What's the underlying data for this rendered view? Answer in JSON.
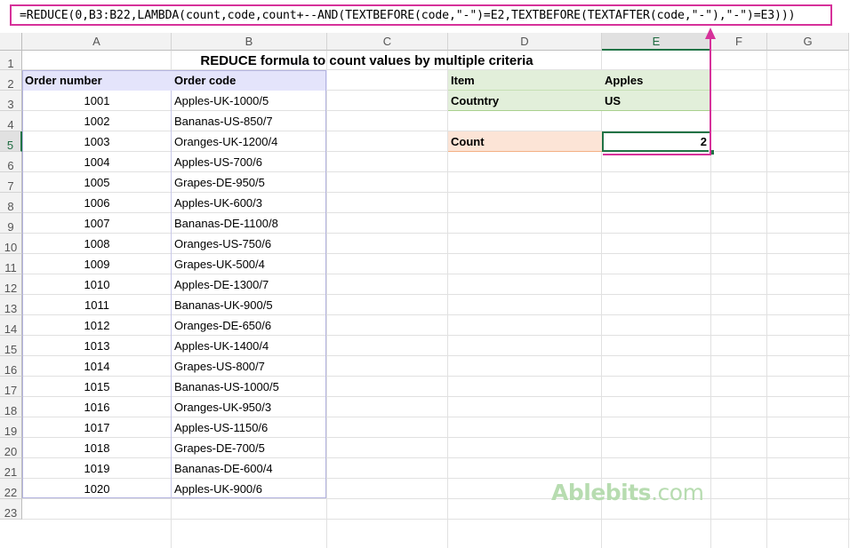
{
  "formula_bar": {
    "formula": "=REDUCE(0,B3:B22,LAMBDA(count,code,count+--AND(TEXTBEFORE(code,\"-\")=E2,TEXTBEFORE(TEXTAFTER(code,\"-\"),\"-\")=E3)))"
  },
  "columns": [
    "A",
    "B",
    "C",
    "D",
    "E",
    "F",
    "G"
  ],
  "selected_column": "E",
  "rows": [
    "1",
    "2",
    "3",
    "4",
    "5",
    "6",
    "7",
    "8",
    "9",
    "10",
    "11",
    "12",
    "13",
    "14",
    "15",
    "16",
    "17",
    "18",
    "19",
    "20",
    "21",
    "22",
    "23"
  ],
  "selected_row": "5",
  "sheet": {
    "title": "REDUCE formula to count values by multiple criteria",
    "table_headers": {
      "order_number": "Order number",
      "order_code": "Order code"
    },
    "table_rows": [
      {
        "number": "1001",
        "code": "Apples-UK-1000/5"
      },
      {
        "number": "1002",
        "code": "Bananas-US-850/7"
      },
      {
        "number": "1003",
        "code": "Oranges-UK-1200/4"
      },
      {
        "number": "1004",
        "code": "Apples-US-700/6"
      },
      {
        "number": "1005",
        "code": "Grapes-DE-950/5"
      },
      {
        "number": "1006",
        "code": "Apples-UK-600/3"
      },
      {
        "number": "1007",
        "code": "Bananas-DE-1100/8"
      },
      {
        "number": "1008",
        "code": "Oranges-US-750/6"
      },
      {
        "number": "1009",
        "code": "Grapes-UK-500/4"
      },
      {
        "number": "1010",
        "code": "Apples-DE-1300/7"
      },
      {
        "number": "1011",
        "code": "Bananas-UK-900/5"
      },
      {
        "number": "1012",
        "code": "Oranges-DE-650/6"
      },
      {
        "number": "1013",
        "code": "Apples-UK-1400/4"
      },
      {
        "number": "1014",
        "code": "Grapes-US-800/7"
      },
      {
        "number": "1015",
        "code": "Bananas-US-1000/5"
      },
      {
        "number": "1016",
        "code": "Oranges-UK-950/3"
      },
      {
        "number": "1017",
        "code": "Apples-US-1150/6"
      },
      {
        "number": "1018",
        "code": "Grapes-DE-700/5"
      },
      {
        "number": "1019",
        "code": "Bananas-DE-600/4"
      },
      {
        "number": "1020",
        "code": "Apples-UK-900/6"
      }
    ],
    "criteria": {
      "item_label": "Item",
      "item_value": "Apples",
      "country_label": "Coutntry",
      "country_value": "US",
      "count_label": "Count",
      "count_value": "2"
    }
  },
  "watermark": {
    "brand": "Ablebits",
    "domain": ".com"
  },
  "colors": {
    "accent_magenta": "#d6319a",
    "header_fill_blue": "#e4e4fb",
    "criteria_fill_green": "#e2efda",
    "count_fill_orange": "#fce4d6",
    "selection_green": "#217346"
  }
}
